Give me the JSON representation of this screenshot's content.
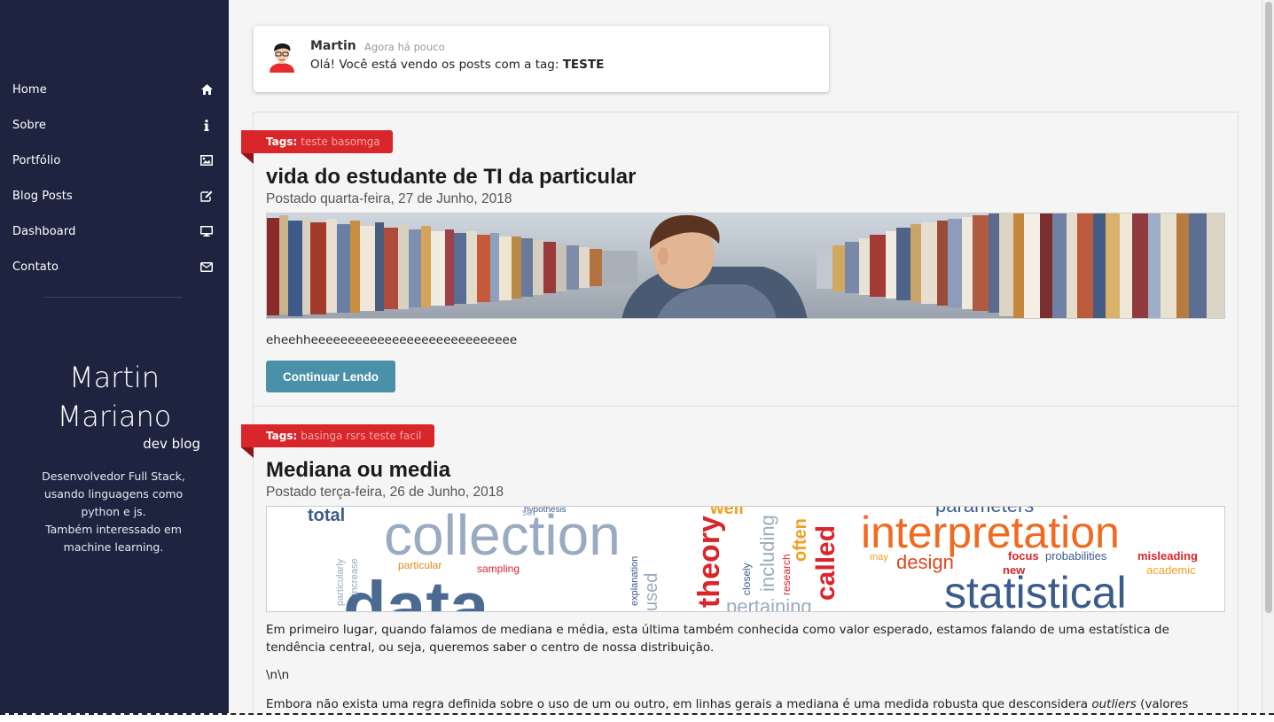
{
  "sidebar": {
    "items": [
      {
        "label": "Home",
        "icon": "home-icon"
      },
      {
        "label": "Sobre",
        "icon": "info-icon"
      },
      {
        "label": "Portfólio",
        "icon": "image-icon"
      },
      {
        "label": "Blog Posts",
        "icon": "edit-icon"
      },
      {
        "label": "Dashboard",
        "icon": "desktop-icon"
      },
      {
        "label": "Contato",
        "icon": "envelope-icon"
      }
    ],
    "profile": {
      "first_name": "Martin",
      "last_name": "Mariano",
      "subtitle": "dev blog",
      "description_1": "Desenvolvedor Full Stack, usando linguagens como python e js.",
      "description_2": "Também interessado em machine learning."
    }
  },
  "toast": {
    "user": "Martin",
    "time": "Agora há pouco",
    "message_prefix": "Olá! Você está vendo os posts com a tag:",
    "tag": "TESTE"
  },
  "posts": [
    {
      "tags_label": "Tags:",
      "tags": "teste basomga",
      "title": "vida do estudante de TI da particular",
      "date": "Postado quarta-feira, 27 de Junho, 2018",
      "excerpt": "eheehheeeeeeeeeeeeeeeeeeeeeeeeeeee",
      "button": "Continuar Lendo"
    },
    {
      "tags_label": "Tags:",
      "tags": "basinga rsrs teste facil",
      "title": "Mediana ou media",
      "date": "Postado terça-feira, 26 de Junho, 2018",
      "body_1": "Em primeiro lugar, quando falamos de mediana e média, esta última também conhecida como valor esperado, estamos falando de uma estatística de tendência central, ou seja, queremos saber o centro de nossa distribuição.",
      "body_2": "\\n\\n",
      "body_3_start": "Embora não exista uma regra definida sobre o uso de um ou outro, em linhas gerais a mediana é uma medida robusta que desconsidera",
      "body_3_em": "outliers",
      "body_3_end": "(valores"
    }
  ],
  "wordcloud": [
    "total",
    "collection",
    "interpretation",
    "parameters",
    "data",
    "statistical",
    "design",
    "particular",
    "sampling",
    "focus",
    "probabilities",
    "misleading",
    "academic",
    "new",
    "may",
    "pertaining",
    "research",
    "called",
    "closely",
    "including",
    "often",
    "increase",
    "particularly",
    "hypothesis",
    "set",
    "well",
    "used",
    "theory",
    "explanation"
  ],
  "colors": {
    "sidebar_bg": "#1e2440",
    "accent_red": "#d9262b",
    "button_blue": "#4a90a8"
  }
}
